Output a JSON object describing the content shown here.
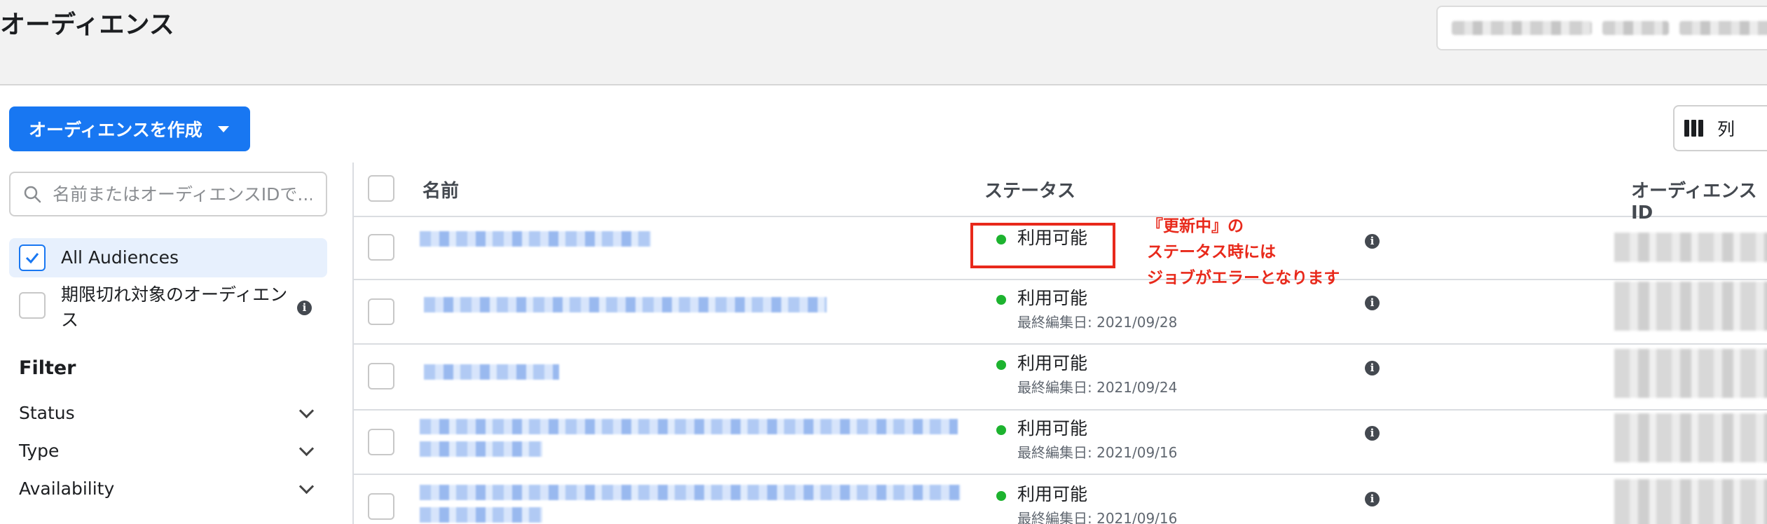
{
  "header": {
    "title": "オーディエンス"
  },
  "toolbar": {
    "create_label": "オーディエンスを作成",
    "columns_label": "列"
  },
  "search": {
    "placeholder": "名前またはオーディエンスIDで..."
  },
  "sidebar": {
    "items": [
      {
        "label": "All Audiences",
        "checked": true
      },
      {
        "label": "期限切れ対象のオーディエンス",
        "checked": false
      }
    ],
    "filter_title": "Filter",
    "filters": [
      {
        "label": "Status"
      },
      {
        "label": "Type"
      },
      {
        "label": "Availability"
      }
    ]
  },
  "table": {
    "columns": [
      "名前",
      "ステータス",
      "オーディエンスID"
    ],
    "rows": [
      {
        "status": "利用可能",
        "updated": ""
      },
      {
        "status": "利用可能",
        "updated": "最終編集日: 2021/09/28"
      },
      {
        "status": "利用可能",
        "updated": "最終編集日: 2021/09/24"
      },
      {
        "status": "利用可能",
        "updated": "最終編集日: 2021/09/16"
      },
      {
        "status": "利用可能",
        "updated": "最終編集日: 2021/09/16"
      }
    ]
  },
  "annotation": {
    "line1": "『更新中』の",
    "line2": "ステータス時には",
    "line3": "ジョブがエラーとなります"
  },
  "colors": {
    "primary": "#1877f2",
    "status_available": "#1db32f",
    "annotation": "#e8291b"
  }
}
